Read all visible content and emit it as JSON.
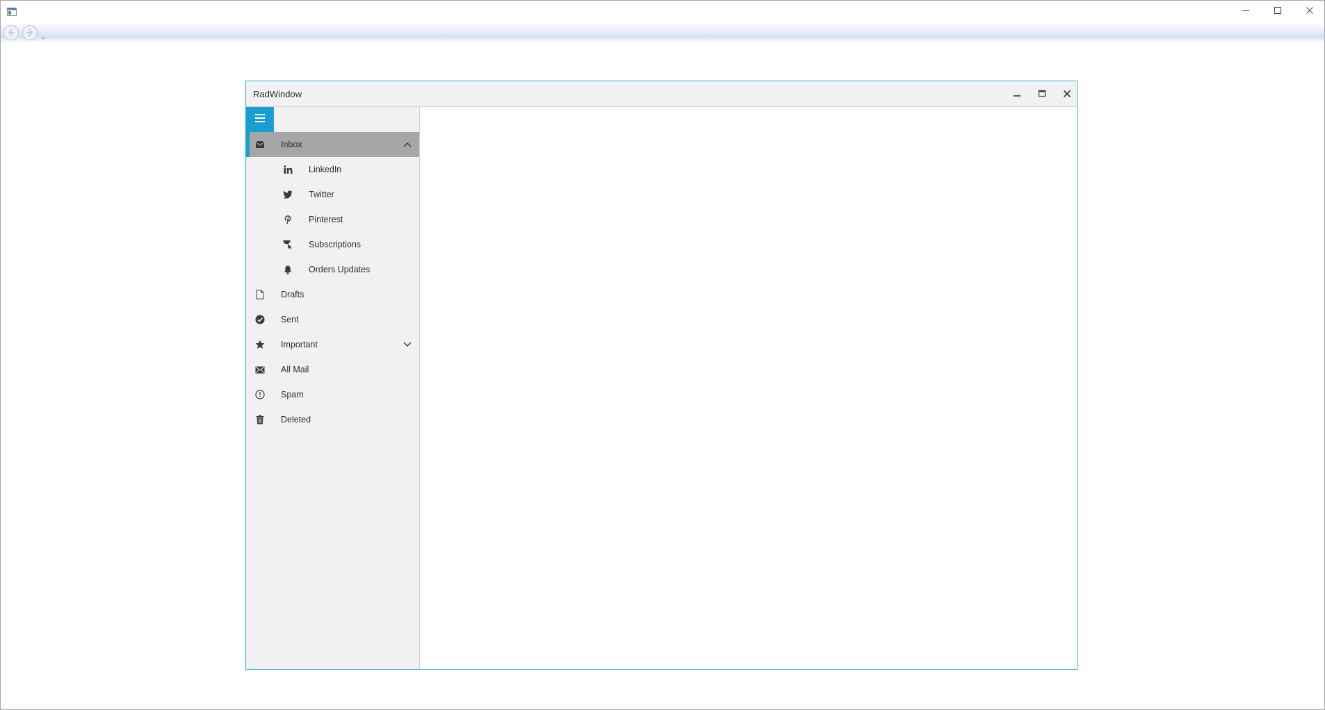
{
  "host": {
    "caption_buttons": [
      "minimize",
      "maximize",
      "close"
    ],
    "nav_buttons": [
      "back",
      "forward"
    ]
  },
  "radwindow": {
    "title": "RadWindow",
    "buttons": [
      "minimize",
      "maximize",
      "close"
    ]
  },
  "navigation": {
    "accent_color": "#1a9ed1",
    "selected_color": "#a6a6a6",
    "items": [
      {
        "label": "Inbox",
        "icon": "inbox-icon",
        "selected": true,
        "expanded": true
      },
      {
        "label": "LinkedIn",
        "icon": "linkedin-icon",
        "child": true
      },
      {
        "label": "Twitter",
        "icon": "twitter-icon",
        "child": true
      },
      {
        "label": "Pinterest",
        "icon": "pinterest-icon",
        "child": true
      },
      {
        "label": "Subscriptions",
        "icon": "subscriptions-icon",
        "child": true
      },
      {
        "label": "Orders Updates",
        "icon": "bell-icon",
        "child": true
      },
      {
        "label": "Drafts",
        "icon": "document-icon"
      },
      {
        "label": "Sent",
        "icon": "check-circle-icon"
      },
      {
        "label": "Important",
        "icon": "star-icon",
        "expanded": false
      },
      {
        "label": "All Mail",
        "icon": "envelope-icon"
      },
      {
        "label": "Spam",
        "icon": "exclamation-circle-icon"
      },
      {
        "label": "Deleted",
        "icon": "trash-icon"
      }
    ]
  }
}
